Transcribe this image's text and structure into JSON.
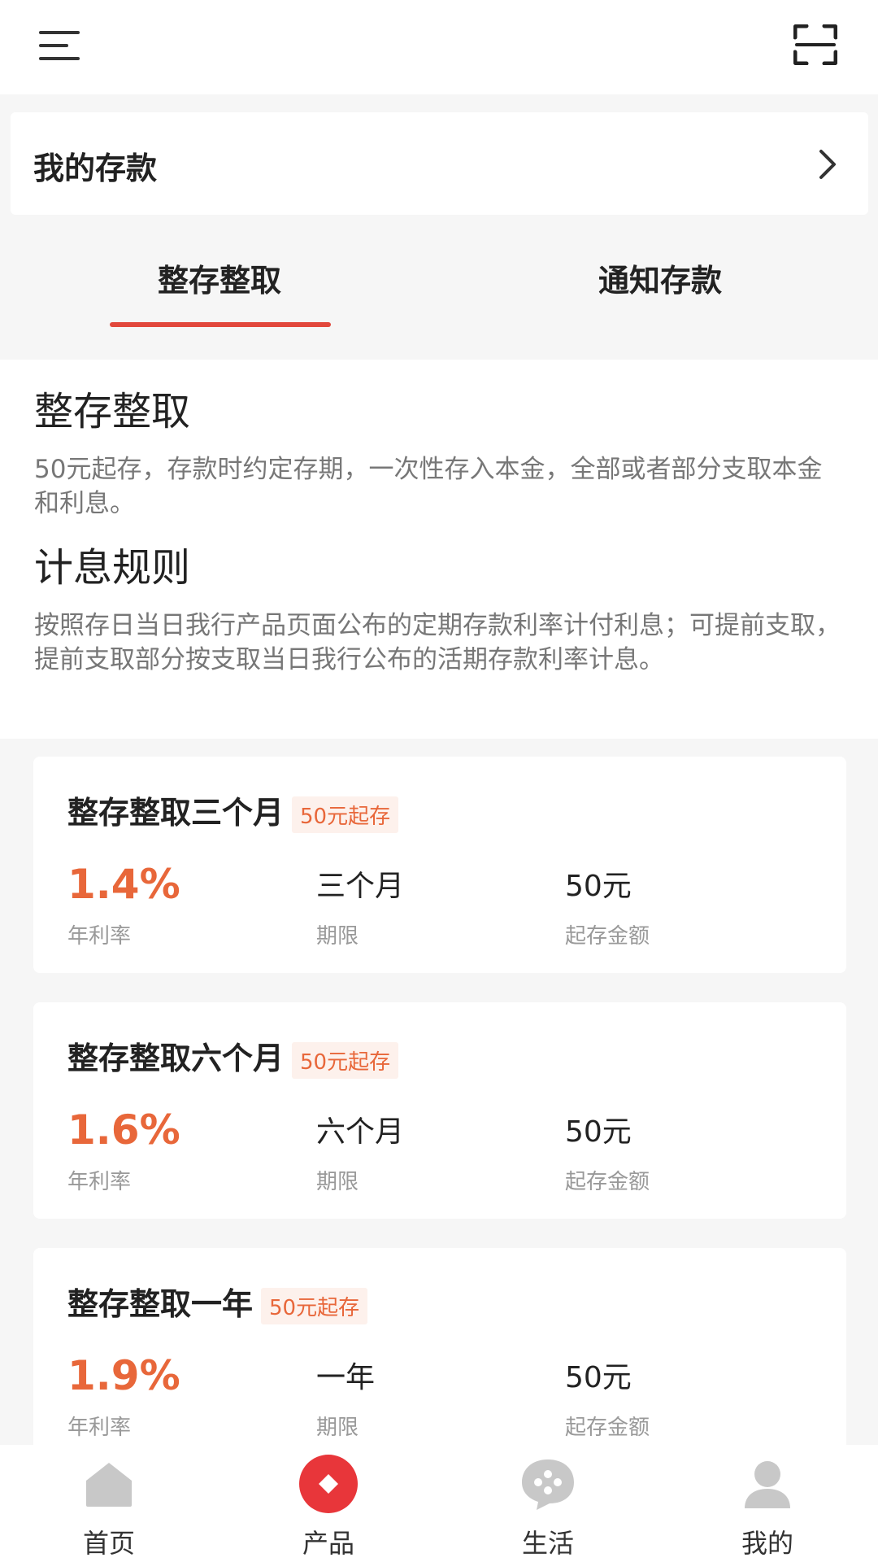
{
  "topbar": {
    "menu_icon": "menu-icon",
    "scan_icon": "scan-icon"
  },
  "my_deposit": {
    "label": "我的存款"
  },
  "tabs": [
    {
      "label": "整存整取",
      "active": true
    },
    {
      "label": "通知存款",
      "active": false
    }
  ],
  "intro": {
    "heading": "整存整取",
    "description": "50元起存，存款时约定存期，一次性存入本金，全部或者部分支取本金和利息。",
    "rules_heading": "计息规则",
    "rules_text": "按照存日当日我行产品页面公布的定期存款利率计付利息；可提前支取，提前支取部分按支取当日我行公布的活期存款利率计息。"
  },
  "products": [
    {
      "title": "整存整取三个月",
      "badge": "50元起存",
      "rate": "1.4%",
      "rate_label": "年利率",
      "term": "三个月",
      "term_label": "期限",
      "min": "50元",
      "min_label": "起存金额"
    },
    {
      "title": "整存整取六个月",
      "badge": "50元起存",
      "rate": "1.6%",
      "rate_label": "年利率",
      "term": "六个月",
      "term_label": "期限",
      "min": "50元",
      "min_label": "起存金额"
    },
    {
      "title": "整存整取一年",
      "badge": "50元起存",
      "rate": "1.9%",
      "rate_label": "年利率",
      "term": "一年",
      "term_label": "期限",
      "min": "50元",
      "min_label": "起存金额"
    }
  ],
  "bottom_nav": [
    {
      "label": "首页",
      "icon": "home-icon"
    },
    {
      "label": "产品",
      "icon": "product-icon",
      "active": true
    },
    {
      "label": "生活",
      "icon": "life-icon"
    },
    {
      "label": "我的",
      "icon": "user-icon"
    }
  ],
  "colors": {
    "accent": "#e2483c",
    "rate": "#e8673a",
    "nav_inactive": "#c8c8c8"
  }
}
